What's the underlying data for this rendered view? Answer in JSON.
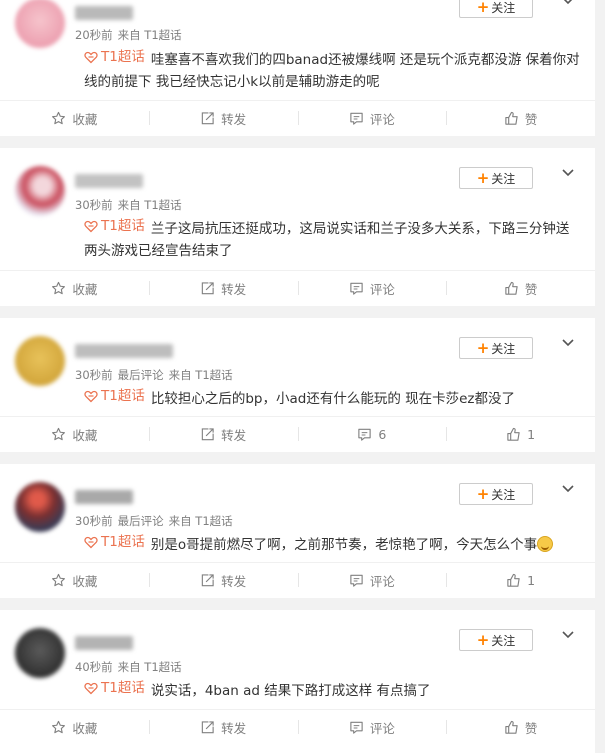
{
  "labels": {
    "follow": "关注",
    "favorite": "收藏",
    "repost": "转发",
    "comment": "评论",
    "like": "赞"
  },
  "posts": [
    {
      "time": "20秒前",
      "last_comment": "",
      "source": "来自 T1超话",
      "topic": "T1超话",
      "content": "哇塞喜不喜欢我们的四banad还被爆线啊 还是玩个派克都没游 保着你对线的前提下 我已经快忘记小k以前是辅助游走的呢",
      "comment_count": "",
      "like_count": ""
    },
    {
      "time": "30秒前",
      "last_comment": "",
      "source": "来自 T1超话",
      "topic": "T1超话",
      "content": "兰子这局抗压还挺成功，这局说实话和兰子没多大关系，下路三分钟送两头游戏已经宣告结束了",
      "comment_count": "",
      "like_count": ""
    },
    {
      "time": "30秒前",
      "last_comment": "最后评论",
      "source": "来自 T1超话",
      "topic": "T1超话",
      "content": "比较担心之后的bp，小ad还有什么能玩的 现在卡莎ez都没了",
      "comment_count": "6",
      "like_count": "1"
    },
    {
      "time": "30秒前",
      "last_comment": "最后评论",
      "source": "来自 T1超话",
      "topic": "T1超话",
      "content": "别是o哥提前燃尽了啊，之前那节奏，老惊艳了啊，今天怎么个事",
      "comment_count": "",
      "like_count": "1"
    },
    {
      "time": "40秒前",
      "last_comment": "",
      "source": "来自 T1超话",
      "topic": "T1超话",
      "content": "说实话，4ban ad 结果下路打成这样 有点搞了",
      "comment_count": "",
      "like_count": ""
    }
  ],
  "colors": {
    "accent": "#ff8200",
    "topic": "#eb7350",
    "muted": "#808080"
  },
  "icons": [
    "star-icon",
    "repost-icon",
    "comment-icon",
    "thumbs-up-icon",
    "chevron-down-icon",
    "topic-icon",
    "laugh-cry-emoji-icon"
  ]
}
